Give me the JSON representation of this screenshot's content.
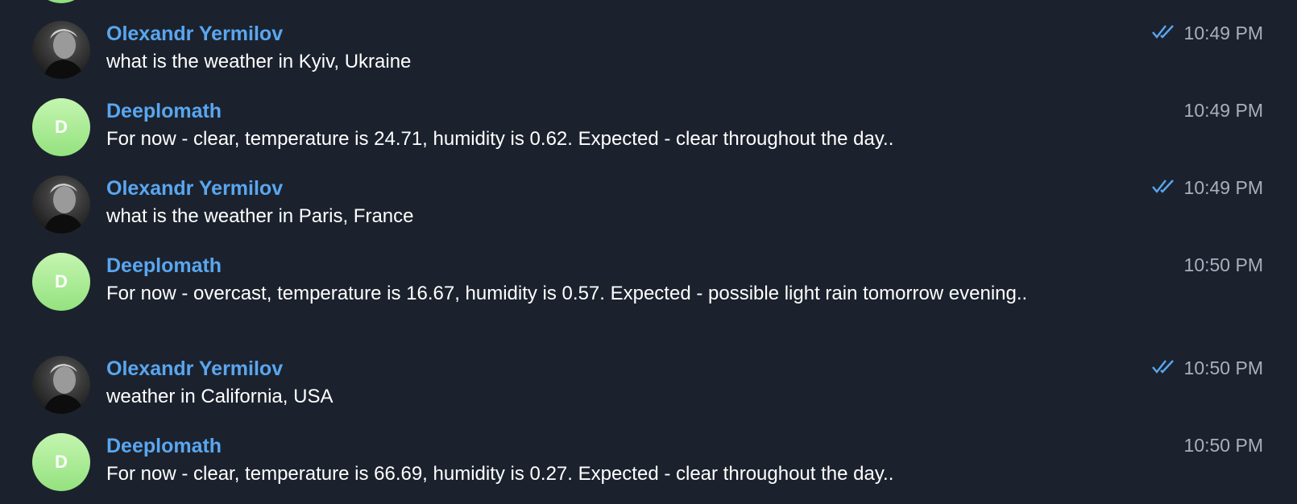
{
  "colors": {
    "background": "#1b222d",
    "name": "#5aa6f0",
    "text": "#ffffff",
    "time": "#a7b0bc",
    "bot_avatar": "#a8eb93"
  },
  "messages": [
    {
      "sender": "Olexandr Yermilov",
      "text": "what is the weather in Kyiv, Ukraine",
      "time": "10:49 PM",
      "read_icon": "double-check-icon"
    },
    {
      "sender": "Deeplomath",
      "avatar_letter": "D",
      "text": "For now - clear, temperature is 24.71, humidity is 0.62. Expected - clear throughout the day..",
      "time": "10:49 PM"
    },
    {
      "sender": "Olexandr Yermilov",
      "text": "what is the weather in Paris, France",
      "time": "10:49 PM",
      "read_icon": "double-check-icon"
    },
    {
      "sender": "Deeplomath",
      "avatar_letter": "D",
      "text": "For now - overcast, temperature is 16.67, humidity is 0.57. Expected - possible light rain tomorrow evening..",
      "time": "10:50 PM"
    },
    {
      "sender": "Olexandr Yermilov",
      "text": "weather in California, USA",
      "time": "10:50 PM",
      "read_icon": "double-check-icon"
    },
    {
      "sender": "Deeplomath",
      "avatar_letter": "D",
      "text": "For now - clear, temperature is 66.69, humidity is 0.27. Expected - clear throughout the day..",
      "time": "10:50 PM"
    }
  ]
}
